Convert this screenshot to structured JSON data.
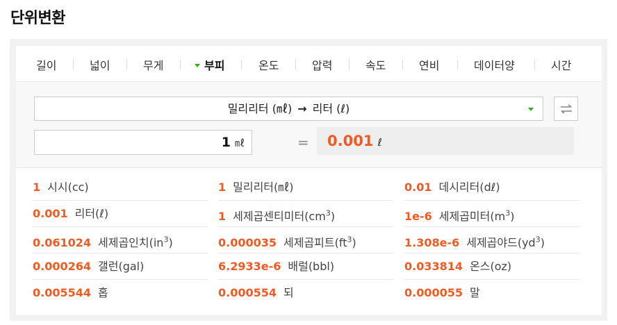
{
  "page": {
    "title": "단위변환"
  },
  "tabs": [
    "길이",
    "넓이",
    "무게",
    "부피",
    "온도",
    "압력",
    "속도",
    "연비",
    "데이터양",
    "시간"
  ],
  "active_tab": "부피",
  "converter": {
    "from_label": "밀리리터 (㎖)",
    "arrow": "→",
    "to_label": "리터 (ℓ)",
    "input_value": "1",
    "input_unit": "㎖",
    "equals": "=",
    "result_value": "0.001",
    "result_unit": "ℓ",
    "swap_icon": "swap-arrows-icon"
  },
  "results": [
    [
      {
        "num": "1",
        "name": "시시(cc)"
      },
      {
        "num": "1",
        "name": "밀리리터(㎖)"
      },
      {
        "num": "0.01",
        "name": "데시리터(dℓ)"
      }
    ],
    [
      {
        "num": "0.001",
        "name": "리터(ℓ)"
      },
      {
        "num": "1",
        "name": "세제곱센티미터(cm",
        "sup": "3",
        "tail": ")"
      },
      {
        "num": "1e-6",
        "name": "세제곱미터(m",
        "sup": "3",
        "tail": ")"
      }
    ],
    [
      {
        "num": "0.061024",
        "name": "세제곱인치(in",
        "sup": "3",
        "tail": ")"
      },
      {
        "num": "0.000035",
        "name": "세제곱피트(ft",
        "sup": "3",
        "tail": ")"
      },
      {
        "num": "1.308e-6",
        "name": "세제곱야드(yd",
        "sup": "3",
        "tail": ")"
      }
    ],
    [
      {
        "num": "0.000264",
        "name": "갤런(gal)"
      },
      {
        "num": "6.2933e-6",
        "name": "배럴(bbl)"
      },
      {
        "num": "0.033814",
        "name": "온스(oz)"
      }
    ],
    [
      {
        "num": "0.005544",
        "name": "홉"
      },
      {
        "num": "0.000554",
        "name": "되"
      },
      {
        "num": "0.000055",
        "name": "말"
      }
    ]
  ],
  "colors": {
    "accent": "#f15b22",
    "tab_marker": "#2db400"
  }
}
